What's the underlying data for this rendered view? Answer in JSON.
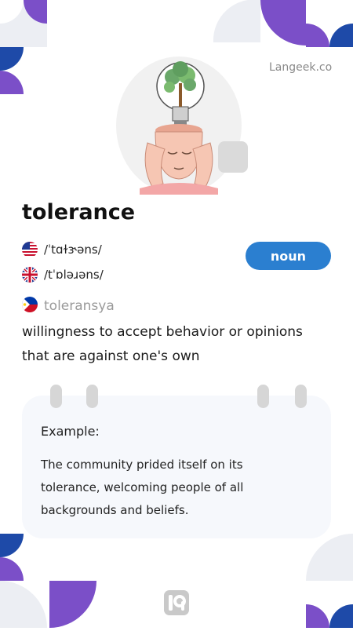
{
  "source": "Langeek.co",
  "word": "tolerance",
  "part_of_speech": "noun",
  "pronunciations": [
    {
      "flag_icon": "us-flag-icon",
      "ipa": "/ˈtɑɫɝəns/"
    },
    {
      "flag_icon": "uk-flag-icon",
      "ipa": "/tˈɒləɹəns/"
    }
  ],
  "translation": {
    "flag_icon": "philippines-flag-icon",
    "text": "toleransya"
  },
  "definition": "willingness to accept behavior or opinions that are against one's own",
  "example": {
    "label": "Example:",
    "text": "The community prided itself on its tolerance, welcoming people of all backgrounds and beliefs."
  },
  "colors": {
    "accent_purple": "#7b4fc8",
    "accent_blue": "#1e4aa8",
    "badge_blue": "#2b7fd0",
    "card_background": "#f6f8fc"
  }
}
